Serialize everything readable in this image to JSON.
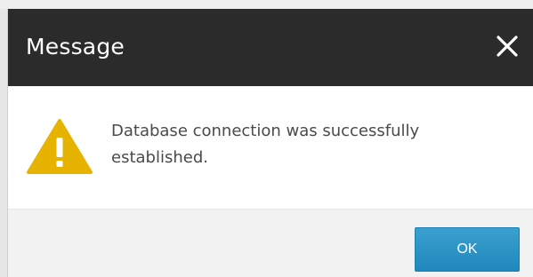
{
  "dialog": {
    "title": "Message",
    "close_icon": "close-icon",
    "message": "Database connection was successfully established.",
    "status_icon": "warning-triangle-icon",
    "ok_label": "OK"
  },
  "colors": {
    "title_bar": "#2b2b2b",
    "warning_yellow": "#e6b400",
    "ok_button": "#2b93c7"
  }
}
